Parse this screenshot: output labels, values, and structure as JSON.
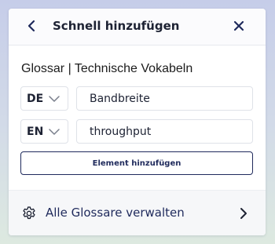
{
  "dialog": {
    "title": "Schnell hinzufügen",
    "back_icon": "chevron-left-icon",
    "close_icon": "close-icon"
  },
  "glossary": {
    "title": "Glossar | Technische Vokabeln"
  },
  "entries": [
    {
      "language": "DE",
      "term": "Bandbreite"
    },
    {
      "language": "EN",
      "term": "throughput"
    }
  ],
  "add_button_label": "Element hinzufügen",
  "footer": {
    "icon": "gear-icon",
    "label": "Alle Glossare verwalten",
    "chevron_icon": "chevron-right-icon"
  },
  "colors": {
    "accent": "#1f2a5c",
    "text": "#1d2233",
    "border": "#dfe2e8"
  }
}
